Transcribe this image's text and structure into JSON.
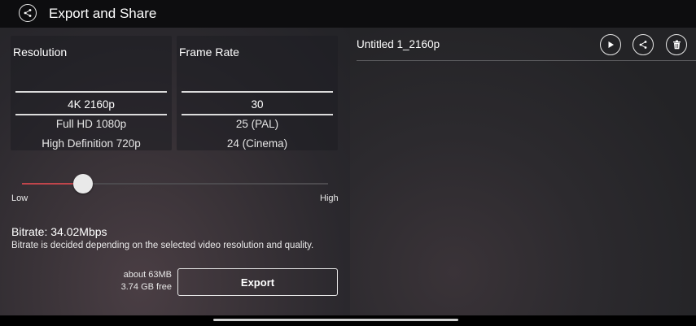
{
  "header": {
    "title": "Export and Share"
  },
  "resolution": {
    "label": "Resolution",
    "options": [
      "4K 2160p",
      "Full HD 1080p",
      "High Definition 720p"
    ],
    "selected": "4K 2160p"
  },
  "frame_rate": {
    "label": "Frame Rate",
    "options": [
      "30",
      "25 (PAL)",
      "24 (Cinema)"
    ],
    "selected": "30"
  },
  "quality": {
    "low_label": "Low",
    "high_label": "High",
    "level": 0.2
  },
  "bitrate": {
    "value_text": "Bitrate: 34.02Mbps",
    "note": "Bitrate is decided depending on the selected video resolution and quality."
  },
  "export": {
    "size": "about 63MB",
    "free": "3.74 GB free",
    "button_label": "Export"
  },
  "project": {
    "file_name": "Untitled 1_2160p"
  },
  "colors": {
    "accent": "#c0454b"
  }
}
